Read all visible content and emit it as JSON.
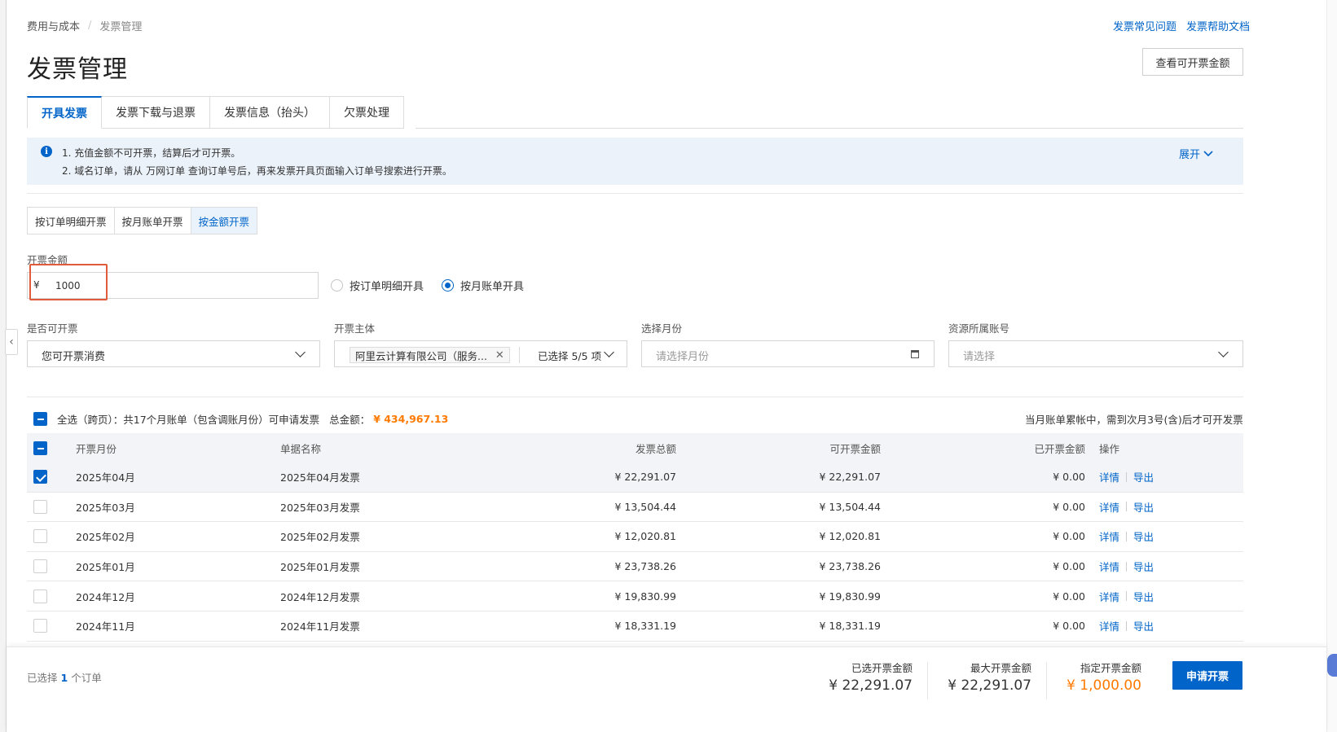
{
  "breadcrumb": {
    "parent": "费用与成本",
    "separator": "/",
    "current": "发票管理"
  },
  "help": {
    "faq": "发票常见问题",
    "docs": "发票帮助文档"
  },
  "title": "发票管理",
  "view_amount_button": "查看可开票金额",
  "tabs": [
    "开具发票",
    "发票下载与退票",
    "发票信息（抬头）",
    "欠票处理"
  ],
  "active_tab": 0,
  "notice": {
    "icon": "info-icon",
    "line1": "1. 充值金额不可开票，结算后才可开票。",
    "line2": "2. 域名订单，请从 万网订单 查询订单号后，再来发票开具页面输入订单号搜索进行开票。",
    "expand": "展开"
  },
  "modes": [
    "按订单明细开票",
    "按月账单开票",
    "按金额开票"
  ],
  "active_mode": 2,
  "amount": {
    "label": "开票金额",
    "currency": "¥",
    "value": "1000"
  },
  "radios": {
    "option1": "按订单明细开具",
    "option2": "按月账单开具",
    "selected": 2
  },
  "filters": {
    "invoiceable": {
      "label": "是否可开票",
      "value": "您可开票消费"
    },
    "entity": {
      "label": "开票主体",
      "tag": "阿里云计算有限公司（服务...",
      "selected": "已选择 5/5 项"
    },
    "month": {
      "label": "选择月份",
      "placeholder": "请选择月份"
    },
    "account": {
      "label": "资源所属账号",
      "placeholder": "请选择"
    }
  },
  "summary": {
    "text": "全选（跨页）：共17个月账单（包含调账月份）可申请发票",
    "total_label": "总金额：",
    "total": "¥ 434,967.13",
    "right": "当月账单累帐中，需到次月3号(含)后才可开发票"
  },
  "table": {
    "headers": [
      "开票月份",
      "单据名称",
      "发票总额",
      "可开票金额",
      "已开票金额",
      "操作"
    ],
    "rows": [
      {
        "month": "2025年04月",
        "name": "2025年04月发票",
        "total": "¥ 22,291.07",
        "available": "¥ 22,291.07",
        "issued": "¥ 0.00",
        "checked": true
      },
      {
        "month": "2025年03月",
        "name": "2025年03月发票",
        "total": "¥ 13,504.44",
        "available": "¥ 13,504.44",
        "issued": "¥ 0.00",
        "checked": false
      },
      {
        "month": "2025年02月",
        "name": "2025年02月发票",
        "total": "¥ 12,020.81",
        "available": "¥ 12,020.81",
        "issued": "¥ 0.00",
        "checked": false
      },
      {
        "month": "2025年01月",
        "name": "2025年01月发票",
        "total": "¥ 23,738.26",
        "available": "¥ 23,738.26",
        "issued": "¥ 0.00",
        "checked": false
      },
      {
        "month": "2024年12月",
        "name": "2024年12月发票",
        "total": "¥ 19,830.99",
        "available": "¥ 19,830.99",
        "issued": "¥ 0.00",
        "checked": false
      },
      {
        "month": "2024年11月",
        "name": "2024年11月发票",
        "total": "¥ 18,331.19",
        "available": "¥ 18,331.19",
        "issued": "¥ 0.00",
        "checked": false
      }
    ],
    "op_detail": "详情",
    "op_export": "导出"
  },
  "footer": {
    "selected_prefix": "已选择",
    "selected_count": "1",
    "selected_suffix": "个订单",
    "selected_amount_label": "已选开票金额",
    "selected_amount": "¥ 22,291.07",
    "max_amount_label": "最大开票金额",
    "max_amount": "¥ 22,291.07",
    "specified_amount_label": "指定开票金额",
    "specified_amount": "¥ 1,000.00",
    "apply_button": "申请开票"
  },
  "colors": {
    "primary": "#0064c8",
    "accent": "#ff7a00",
    "highlight": "#e05a3c"
  }
}
